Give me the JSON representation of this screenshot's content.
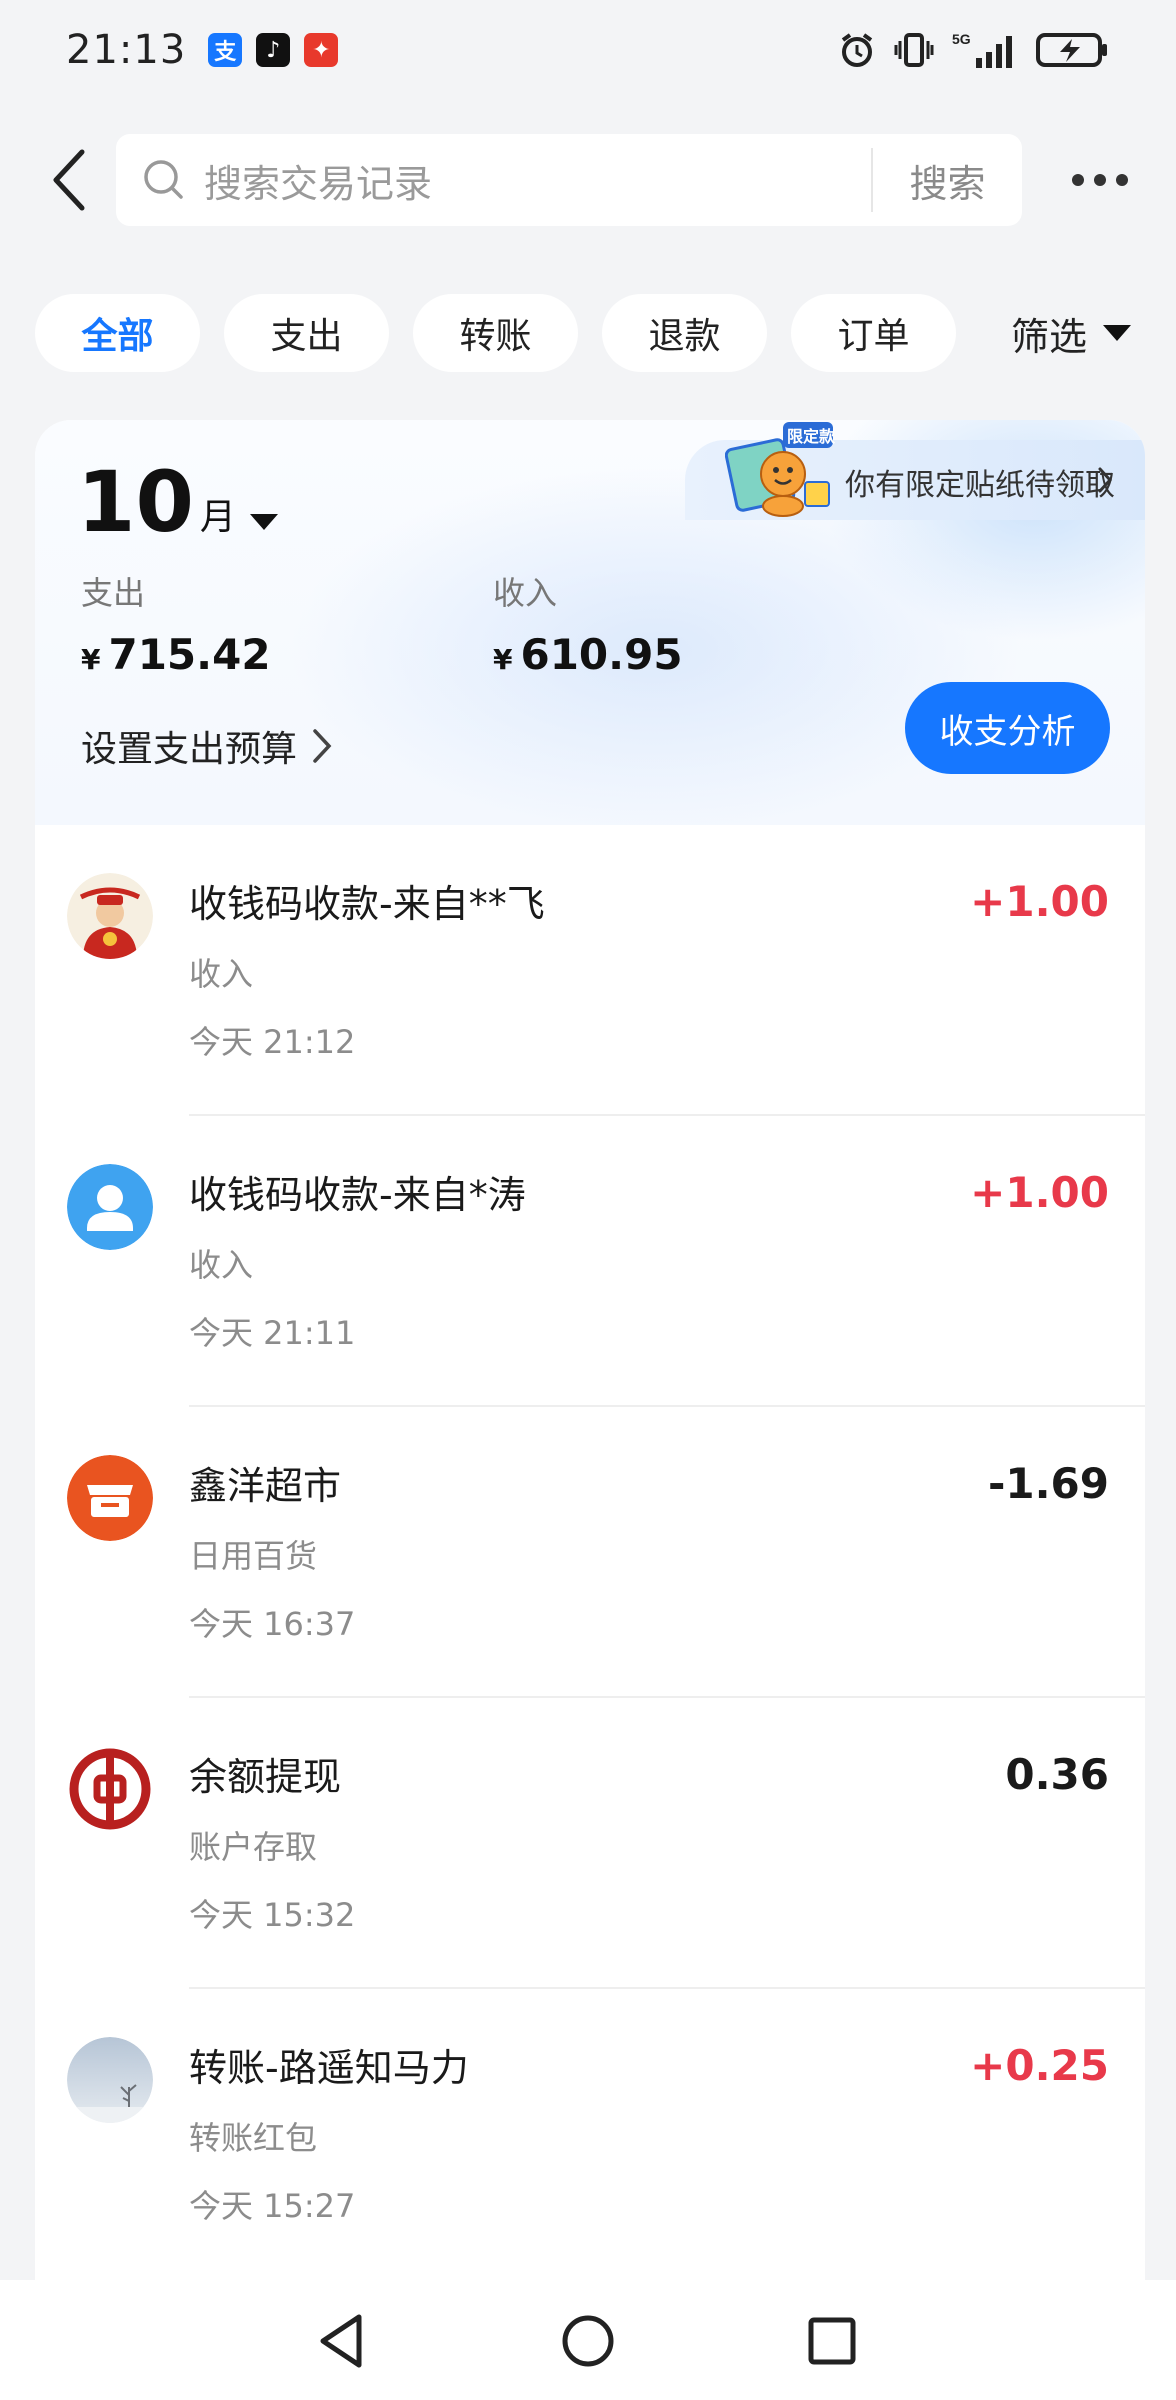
{
  "status_bar": {
    "time": "21:13",
    "notifications": [
      "alipay-icon",
      "tiktok-icon",
      "red-app-icon"
    ],
    "notification_glyphs": [
      "支",
      "♪",
      "✦"
    ],
    "network": "5G"
  },
  "header": {
    "search_placeholder": "搜索交易记录",
    "search_button": "搜索"
  },
  "filters": {
    "chips": [
      {
        "label": "全部",
        "active": true
      },
      {
        "label": "支出",
        "active": false
      },
      {
        "label": "转账",
        "active": false
      },
      {
        "label": "退款",
        "active": false
      },
      {
        "label": "订单",
        "active": false
      }
    ],
    "filter_label": "筛选"
  },
  "summary": {
    "month_number": "10",
    "month_unit": "月",
    "expense_label": "支出",
    "expense_currency": "¥",
    "expense_amount": "715.42",
    "income_label": "收入",
    "income_currency": "¥",
    "income_amount": "610.95",
    "budget_link": "设置支出预算",
    "analysis_button": "收支分析",
    "sticker_text": "你有限定贴纸待领取",
    "sticker_badge": "限定款"
  },
  "transactions": [
    {
      "title": "收钱码收款-来自**飞",
      "category": "收入",
      "time": "今天 21:12",
      "amount": "+1.00",
      "type": "income",
      "avatar": "caishen-avatar"
    },
    {
      "title": "收钱码收款-来自*涛",
      "category": "收入",
      "time": "今天 21:11",
      "amount": "+1.00",
      "type": "income",
      "avatar": "default-user-avatar"
    },
    {
      "title": "鑫洋超市",
      "category": "日用百货",
      "time": "今天 16:37",
      "amount": "-1.69",
      "type": "expense",
      "avatar": "store-icon"
    },
    {
      "title": "余额提现",
      "category": "账户存取",
      "time": "今天 15:32",
      "amount": "0.36",
      "type": "neutral",
      "avatar": "bank-of-china-icon"
    },
    {
      "title": "转账-路遥知马力",
      "category": "转账红包",
      "time": "今天 15:27",
      "amount": "+0.25",
      "type": "income",
      "avatar": "landscape-avatar"
    }
  ],
  "colors": {
    "accent": "#1677ff",
    "income": "#e8394a",
    "background": "#f3f4f6"
  }
}
